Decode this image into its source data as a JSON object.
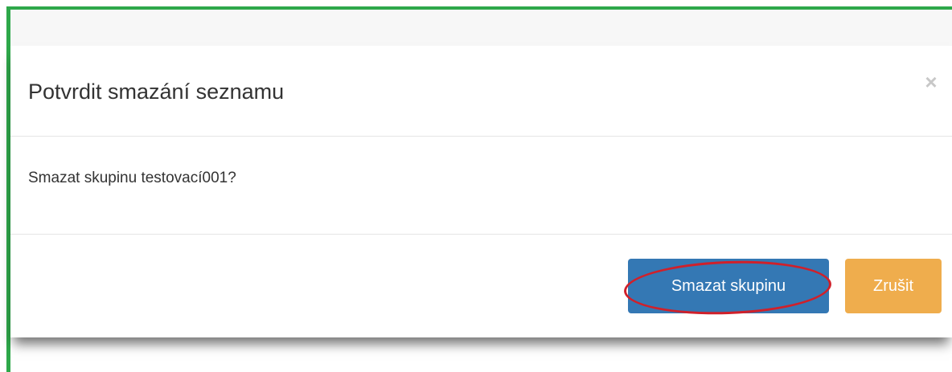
{
  "dialog": {
    "title": "Potvrdit smazání seznamu",
    "close_glyph": "×",
    "close_icon": "close-icon",
    "message": "Smazat skupinu testovací001?",
    "buttons": {
      "delete_label": "Smazat skupinu",
      "cancel_label": "Zrušit"
    }
  },
  "colors": {
    "frame_accent": "#2ea84a",
    "primary_button": "#3478b4",
    "warning_button": "#efad4d",
    "annotation": "#d0202a"
  }
}
